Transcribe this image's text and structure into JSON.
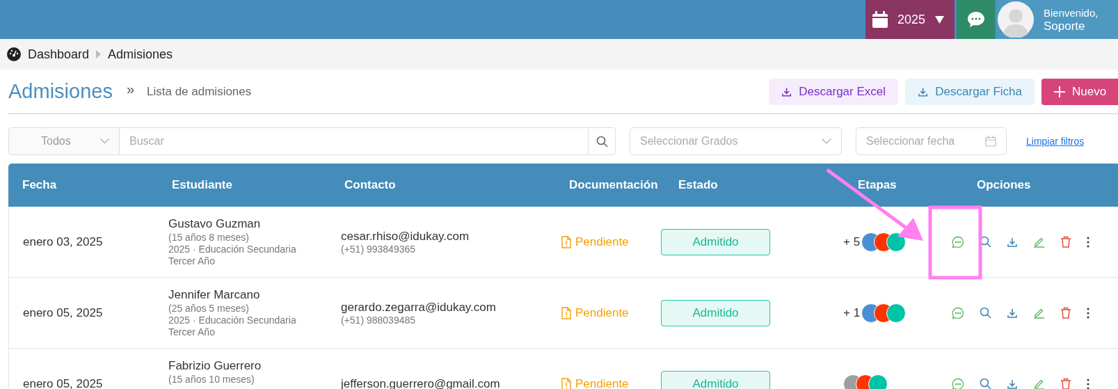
{
  "header": {
    "year": "2025",
    "greeting": "Bienvenido,",
    "user": "Soporte"
  },
  "breadcrumb": [
    {
      "label": "Dashboard"
    },
    {
      "label": "Admisiones"
    }
  ],
  "page": {
    "title": "Admisiones",
    "separator": "»",
    "subtitle": "Lista de admisiones"
  },
  "actions": [
    {
      "kind": "excel",
      "label": "Descargar Excel"
    },
    {
      "kind": "ficha",
      "label": "Descargar Ficha"
    },
    {
      "kind": "new",
      "label": "Nuevo"
    }
  ],
  "filters": {
    "type_select": "Todos",
    "search_placeholder": "Buscar",
    "grades_placeholder": "Seleccionar Grados",
    "date_placeholder": "Seleccionar fecha",
    "clear_link": "Limpiar filtros"
  },
  "table": {
    "columns": [
      "Fecha",
      "Estudiante",
      "Contacto",
      "Documentación",
      "Estado",
      "Etapas",
      "Opciones"
    ],
    "rows": [
      {
        "date": "enero 03, 2025",
        "student": {
          "name": "Gustavo Guzman",
          "age": "(15 años 8 meses)",
          "grade": "2025 · Educación Secundaria",
          "section": "Tercer Año"
        },
        "contact": {
          "email": "cesar.rhiso@idukay.com",
          "phone": "(+51) 993849365"
        },
        "documentation": "Pendiente",
        "status": "Admitido",
        "stages": {
          "extra": "+ 5",
          "dots": [
            {
              "color": "#4a8fd4"
            },
            {
              "color": "#ff3300"
            },
            {
              "color": "#00c4a7"
            }
          ]
        }
      },
      {
        "date": "enero 05, 2025",
        "student": {
          "name": "Jennifer Marcano",
          "age": "(25 años 5 meses)",
          "grade": "2025 · Educación Secundaria",
          "section": "Tercer Año"
        },
        "contact": {
          "email": "gerardo.zegarra@idukay.com",
          "phone": "(+51) 988039485"
        },
        "documentation": "Pendiente",
        "status": "Admitido",
        "stages": {
          "extra": "+ 1",
          "dots": [
            {
              "color": "#4a8fd4"
            },
            {
              "color": "#ff3300"
            },
            {
              "color": "#00c4a7"
            }
          ]
        }
      },
      {
        "date": "enero 05, 2025",
        "student": {
          "name": "Fabrizio Guerrero",
          "age": "(15 años 10 meses)"
        },
        "contact": {
          "email": "jefferson.guerrero@gmail.com"
        },
        "documentation": "Pendiente",
        "status": "Admitido",
        "stages": {
          "dots": [
            {
              "color": "#9e9e9e"
            },
            {
              "color": "#ff3300"
            },
            {
              "color": "#00c4a7"
            }
          ]
        }
      }
    ]
  }
}
